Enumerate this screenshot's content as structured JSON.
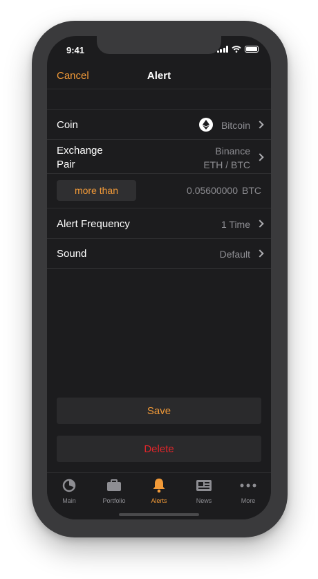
{
  "status_bar": {
    "time": "9:41"
  },
  "nav": {
    "cancel_label": "Cancel",
    "title": "Alert"
  },
  "rows": {
    "coin": {
      "label": "Coin",
      "value": "Bitcoin",
      "icon": "ethereum-icon"
    },
    "exchange_pair": {
      "label_line1": "Exchange",
      "label_line2": "Pair",
      "exchange": "Binance",
      "pair": "ETH / BTC"
    },
    "condition": {
      "button_label": "more than",
      "amount": "0.05600000",
      "unit": "BTC"
    },
    "alert_frequency": {
      "label": "Alert Frequency",
      "value": "1 Time"
    },
    "sound": {
      "label": "Sound",
      "value": "Default"
    }
  },
  "actions": {
    "save_label": "Save",
    "delete_label": "Delete"
  },
  "tabbar": {
    "items": [
      {
        "label": "Main",
        "icon": "pie-chart-icon"
      },
      {
        "label": "Portfolio",
        "icon": "briefcase-icon"
      },
      {
        "label": "Alerts",
        "icon": "bell-icon",
        "active": true
      },
      {
        "label": "News",
        "icon": "newspaper-icon"
      },
      {
        "label": "More",
        "icon": "more-dots-icon"
      }
    ]
  },
  "colors": {
    "accent": "#f29a38",
    "danger": "#e0262a",
    "background": "#1c1c1e",
    "muted": "#8e8e93"
  }
}
